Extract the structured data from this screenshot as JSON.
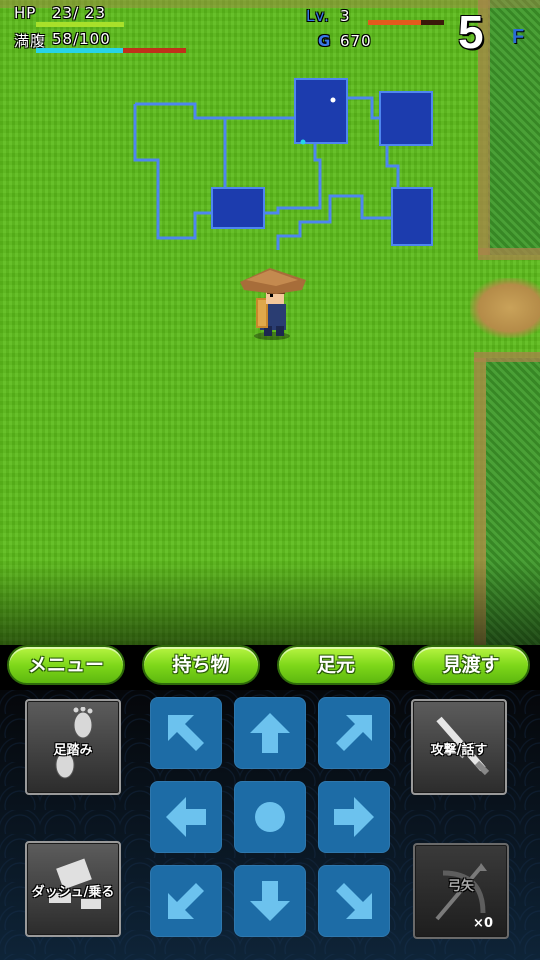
{
  "hud": {
    "hp_label": "HP",
    "hp_value": "23/ 23",
    "hp_fraction": 1.0,
    "fullness_label": "満腹",
    "fullness_value": "58/100",
    "fullness_fraction": 0.58,
    "level_label": "Lv.",
    "level_value": "3",
    "exp_fraction": 0.7,
    "gold_label": "G",
    "gold_value": "670",
    "floor_number": "5",
    "floor_unit": "F"
  },
  "commands": {
    "menu": "メニュー",
    "items": "持ち物",
    "feet": "足元",
    "look": "見渡す"
  },
  "controls": {
    "step": "足踏み",
    "attack": "攻撃/話す",
    "dash": "ダッシュ/乗る",
    "arrow": "弓矢",
    "arrow_count": "×0"
  },
  "colors": {
    "grass": "#5cbb1a",
    "minimap_room": "#1c3cae",
    "minimap_line": "#4e86ef",
    "hp_bar": "#a8e02a",
    "fullness_bar": "#27d3e8",
    "exp_bar": "#e25a1d",
    "command_button": "#7fd81a",
    "dpad": "#1d6ca6"
  },
  "icons": {
    "step": "footprints-icon",
    "attack": "sword-icon",
    "dash": "running-icon",
    "arrow": "bow-arrow-icon"
  }
}
